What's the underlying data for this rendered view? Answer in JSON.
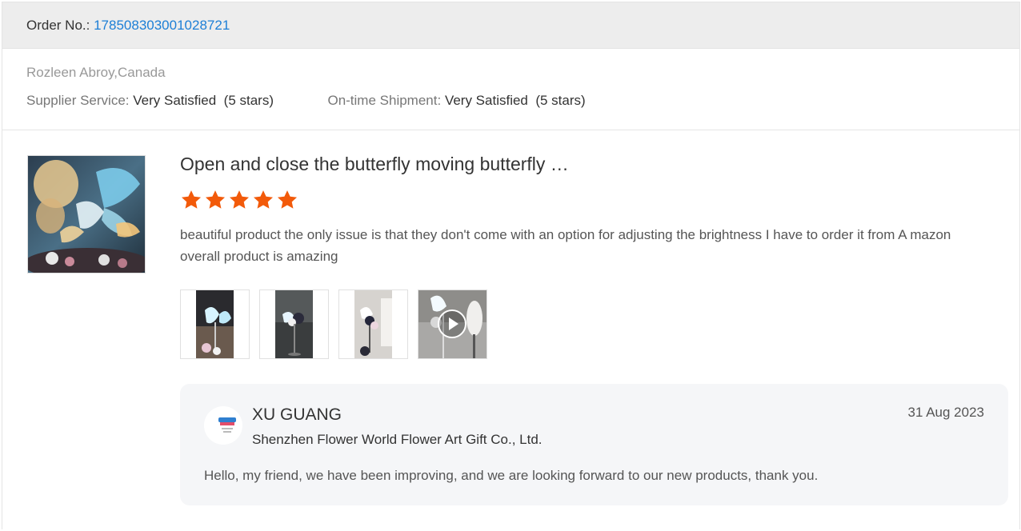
{
  "order": {
    "label": "Order No.: ",
    "number": "178508303001028721"
  },
  "buyer": {
    "name": "Rozleen Abroy,Canada"
  },
  "ratings": {
    "supplier_service_label": "Supplier Service:",
    "supplier_service_value": "Very Satisfied",
    "supplier_service_stars": "(5 stars)",
    "shipment_label": "On-time Shipment:",
    "shipment_value": "Very Satisfied",
    "shipment_stars": "(5 stars)"
  },
  "product": {
    "title": "Open and close the butterfly moving butterfly …",
    "rating": 5,
    "star_color": "#f25a0a",
    "review": "beautiful product the only issue is that they don't come with an option for adjusting the brightness I have to order it from A mazon overall product is amazing",
    "thumbnails": [
      {
        "icon": "butterfly-photo",
        "kind": "image"
      },
      {
        "icon": "butterfly-stand-photo",
        "kind": "image"
      },
      {
        "icon": "butterfly-stand-photo",
        "kind": "image"
      },
      {
        "icon": "play-icon",
        "kind": "video"
      }
    ]
  },
  "reply": {
    "name": "XU GUANG",
    "company": "Shenzhen Flower World Flower Art Gift Co., Ltd.",
    "date": "31 Aug 2023",
    "text": "Hello, my friend, we have been improving, and we are looking forward to our new products, thank you."
  },
  "colors": {
    "link": "#1d7fd6",
    "header_bg": "#ededed",
    "reply_bg": "#f5f6f8"
  }
}
